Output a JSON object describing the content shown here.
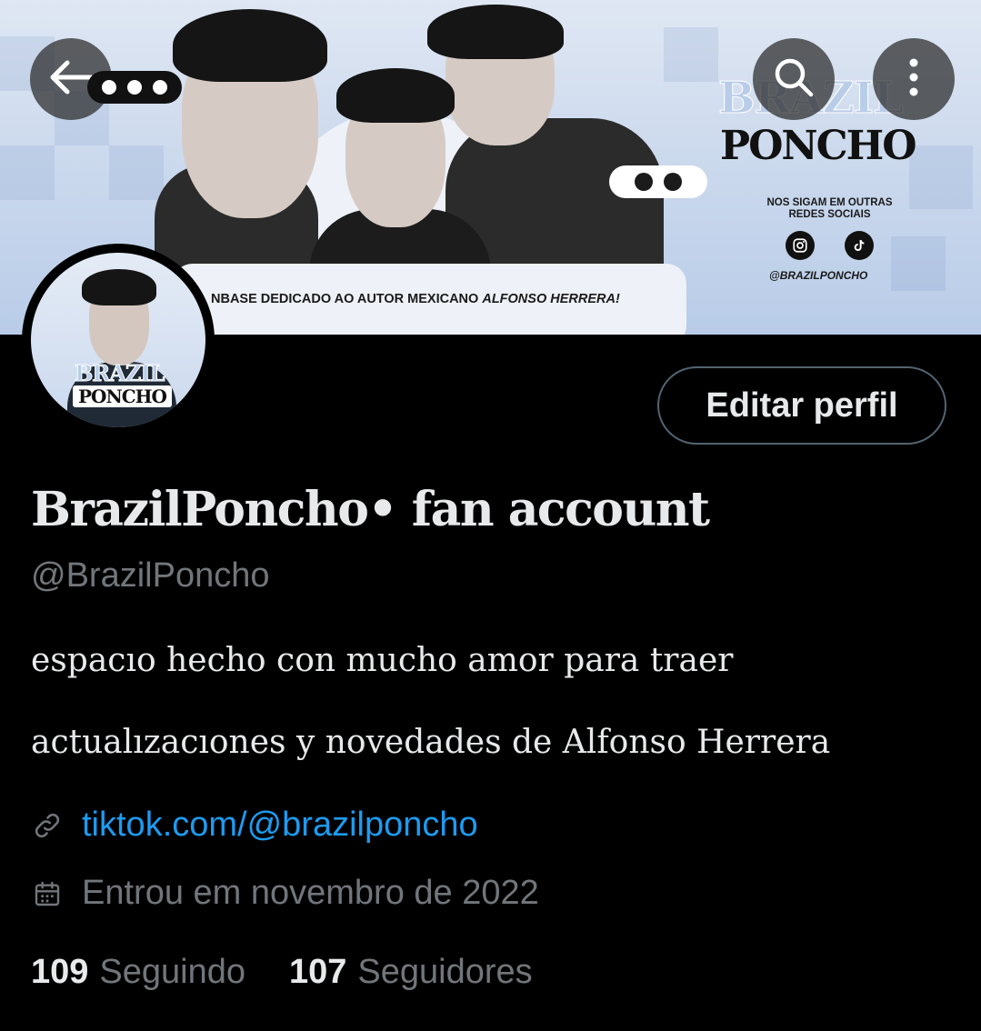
{
  "banner": {
    "logo_top": "BRAZIL",
    "logo_main": "PONCHO",
    "follow_text": "NOS SIGAM EM OUTRAS REDES SOCIAIS",
    "handle": "@BRAZILPONCHO",
    "tagline_prefix": "NBASE DEDICADO AO AUTOR MEXICANO ",
    "tagline_name": "ALFONSO HERRERA!"
  },
  "avatar": {
    "logo_top": "BRAZIL",
    "logo_main": "PONCHO"
  },
  "header": {
    "back_icon": "arrow-left-icon",
    "search_icon": "search-icon",
    "more_icon": "more-vertical-icon"
  },
  "profile": {
    "edit_label": "Editar perfil",
    "display_name": "BrazilPoncho• fan account",
    "handle": "@BrazilPoncho",
    "bio_line1": "espacıo hecho con mucho amor para traer",
    "bio_line2": "actualızacıones y novedades de Alfonso Herrera",
    "link": "tiktok.com/@brazilponcho",
    "joined": "Entrou em novembro de 2022"
  },
  "stats": {
    "following_count": "109",
    "following_label": "Seguindo",
    "followers_count": "107",
    "followers_label": "Seguidores"
  },
  "colors": {
    "background": "#000000",
    "text": "#e7e9ea",
    "muted": "#71767b",
    "link": "#1d9bf0",
    "banner_blue": "#c7d6ec"
  }
}
